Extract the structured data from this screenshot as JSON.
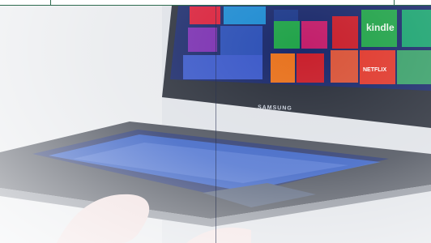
{
  "photo": {
    "device_brand_text": "SAMSUNG",
    "tile_labels": [
      "kindle",
      "NETFLIX"
    ],
    "colors": {
      "frame_border": "#2e6b4f",
      "screen_bg": "#1b2a6b",
      "tile_green": "#22a34a",
      "tile_purple": "#6a2fa0",
      "tile_orange": "#e8731f",
      "tile_red": "#c8202c",
      "tile_magenta": "#c21f6b",
      "keyboard_glow": "#3e6fe0",
      "laptop_body": "#4a4f5a"
    }
  }
}
